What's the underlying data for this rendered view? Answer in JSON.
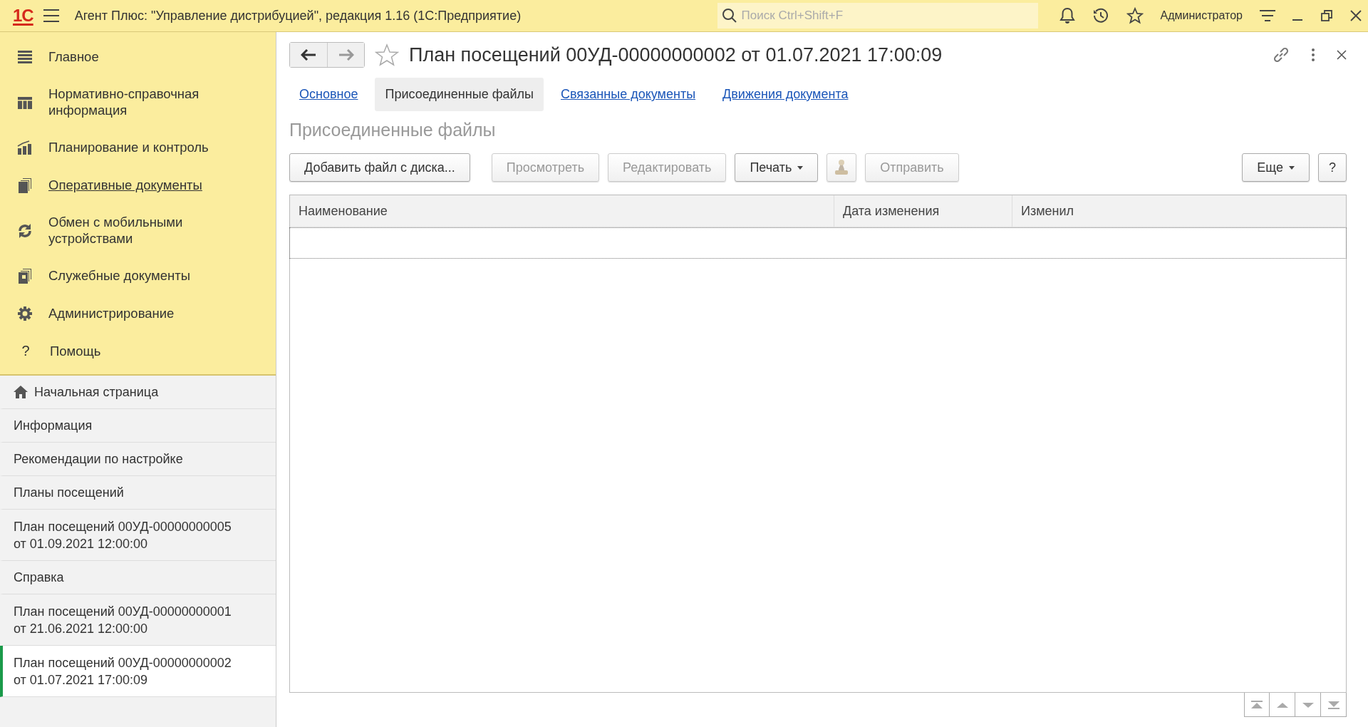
{
  "window": {
    "logo": "1С",
    "title": "Агент Плюс: \"Управление дистрибуцией\", редакция 1.16  (1С:Предприятие)",
    "search": {
      "placeholder": "Поиск Ctrl+Shift+F"
    },
    "user": "Администратор"
  },
  "sections": [
    {
      "kind": "menu",
      "label": "Главное",
      "hovered": false
    },
    {
      "kind": "catalog",
      "label": "Нормативно-справочная информация",
      "hovered": false
    },
    {
      "kind": "chart",
      "label": "Планирование и контроль",
      "hovered": false
    },
    {
      "kind": "documents",
      "label": "Оперативные документы",
      "hovered": true
    },
    {
      "kind": "sync",
      "label": "Обмен с мобильными устройствами",
      "hovered": false
    },
    {
      "kind": "service",
      "label": "Служебные документы",
      "hovered": false
    },
    {
      "kind": "gear",
      "label": "Администрирование",
      "hovered": false
    },
    {
      "kind": "help",
      "glyph": "?",
      "label": "Помощь",
      "hovered": false
    }
  ],
  "open_windows": [
    {
      "kind": "home",
      "label": "Начальная страница",
      "selected": false
    },
    {
      "kind": "plain",
      "label": "Информация",
      "selected": false
    },
    {
      "kind": "plain",
      "label": "Рекомендации по настройке",
      "selected": false
    },
    {
      "kind": "plain",
      "label": "Планы посещений",
      "selected": false
    },
    {
      "kind": "plain",
      "label": "План посещений 00УД-00000000005 от 01.09.2021 12:00:00",
      "selected": false
    },
    {
      "kind": "plain",
      "label": "Справка",
      "selected": false
    },
    {
      "kind": "plain",
      "label": "План посещений 00УД-00000000001 от 21.06.2021 12:00:00",
      "selected": false
    },
    {
      "kind": "plain",
      "label": "План посещений 00УД-00000000002 от 01.07.2021 17:00:09",
      "selected": true
    }
  ],
  "form": {
    "title": "План посещений 00УД-00000000002 от 01.07.2021 17:00:09",
    "favorite": false,
    "tabs": [
      {
        "label": "Основное",
        "selected": false
      },
      {
        "label": "Присоединенные файлы",
        "selected": true
      },
      {
        "label": "Связанные документы",
        "selected": false
      },
      {
        "label": "Движения документа",
        "selected": false
      }
    ],
    "section_title": "Присоединенные файлы",
    "buttons": [
      {
        "kind": "text",
        "label": "Добавить файл с диска...",
        "disabled": false,
        "dropdown": false
      },
      {
        "kind": "text",
        "label": "Просмотреть",
        "disabled": true,
        "dropdown": false
      },
      {
        "kind": "text",
        "label": "Редактировать",
        "disabled": true,
        "dropdown": false
      },
      {
        "kind": "text",
        "label": "Печать",
        "disabled": false,
        "dropdown": true
      },
      {
        "kind": "stamp",
        "disabled": true
      },
      {
        "kind": "text",
        "label": "Отправить",
        "disabled": true,
        "dropdown": false
      },
      {
        "kind": "spacer"
      },
      {
        "kind": "text",
        "label": "Еще",
        "disabled": false,
        "dropdown": true
      },
      {
        "kind": "text",
        "label": "?",
        "disabled": false,
        "dropdown": false
      }
    ],
    "table": {
      "columns": [
        "Наименование",
        "Дата изменения",
        "Изменил"
      ]
    }
  }
}
